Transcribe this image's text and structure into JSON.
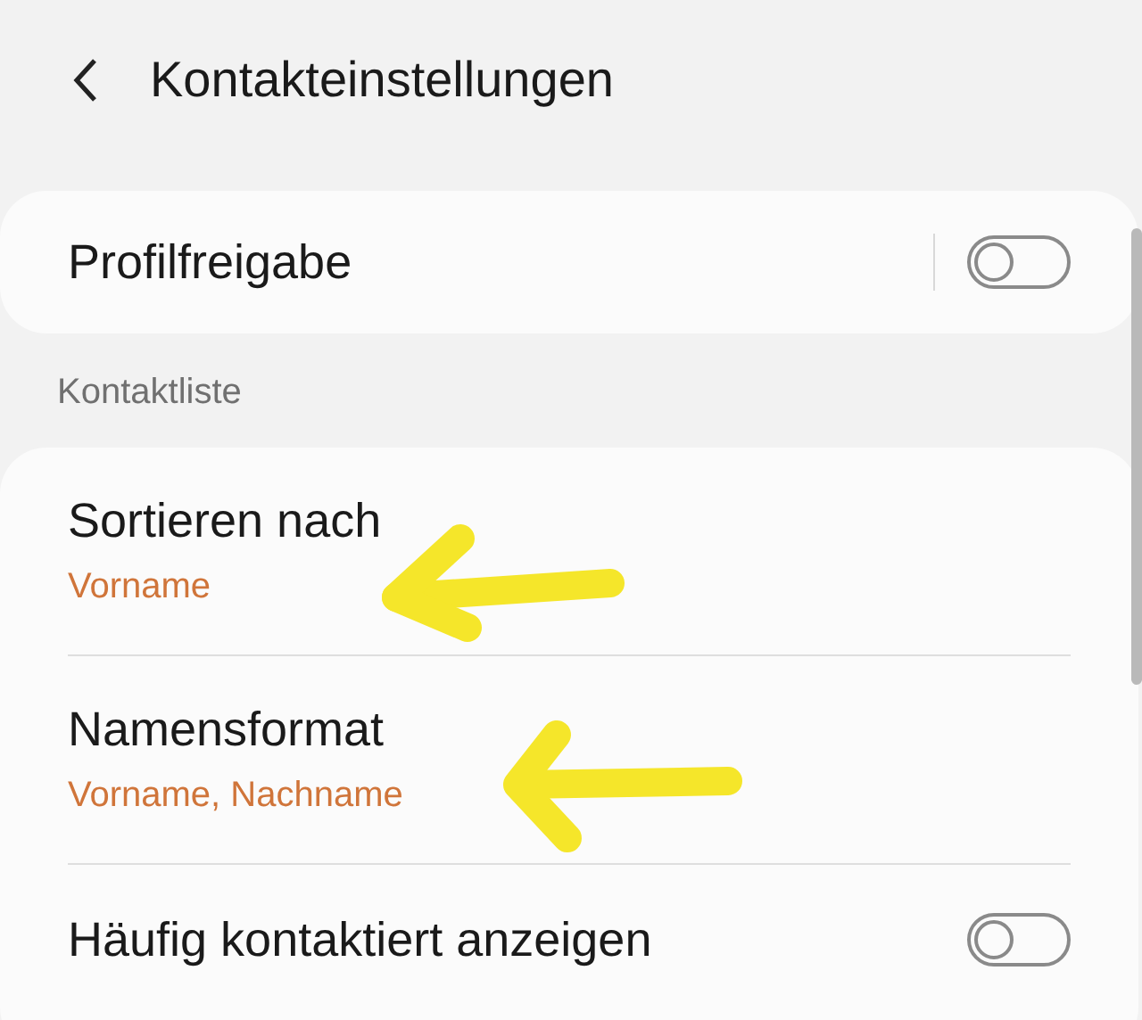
{
  "header": {
    "title": "Kontakteinstellungen"
  },
  "profile_sharing": {
    "label": "Profilfreigabe",
    "on": false
  },
  "section": {
    "title": "Kontaktliste"
  },
  "items": [
    {
      "kind": "value",
      "label": "Sortieren nach",
      "value": "Vorname"
    },
    {
      "kind": "value",
      "label": "Namensformat",
      "value": "Vorname, Nachname"
    },
    {
      "kind": "switch",
      "label": "Häufig kontaktiert anzeigen",
      "on": false
    }
  ]
}
